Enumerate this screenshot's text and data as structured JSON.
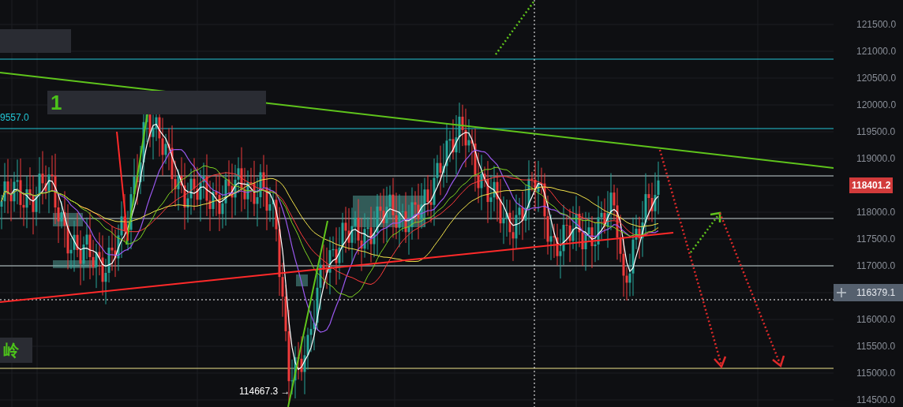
{
  "chart_labels": [
    {
      "kind": "box",
      "text": "1"
    },
    {
      "kind": "price",
      "text": "9557.0"
    },
    {
      "kind": "box",
      "text": "岭"
    },
    {
      "kind": "arrow",
      "text": "114667.3 →"
    }
  ],
  "price_axis": [
    {
      "kind": "tick",
      "label": "121500.0"
    },
    {
      "kind": "tick",
      "label": "121000.0"
    },
    {
      "kind": "tick",
      "label": "120500.0"
    },
    {
      "kind": "tick",
      "label": "120000.0"
    },
    {
      "kind": "tick",
      "label": "119500.0"
    },
    {
      "kind": "tick",
      "label": "119000.0"
    },
    {
      "kind": "last_price",
      "label": "118401.2"
    },
    {
      "kind": "tick",
      "label": "118000.0"
    },
    {
      "kind": "tick",
      "label": "117500.0"
    },
    {
      "kind": "tick",
      "label": "117000.0"
    },
    {
      "kind": "crosshair",
      "label": "116379.1"
    },
    {
      "kind": "tick",
      "label": "116000.0"
    },
    {
      "kind": "tick",
      "label": "115500.0"
    },
    {
      "kind": "tick",
      "label": "115000.0"
    },
    {
      "kind": "tick",
      "label": "114500.0"
    }
  ]
}
